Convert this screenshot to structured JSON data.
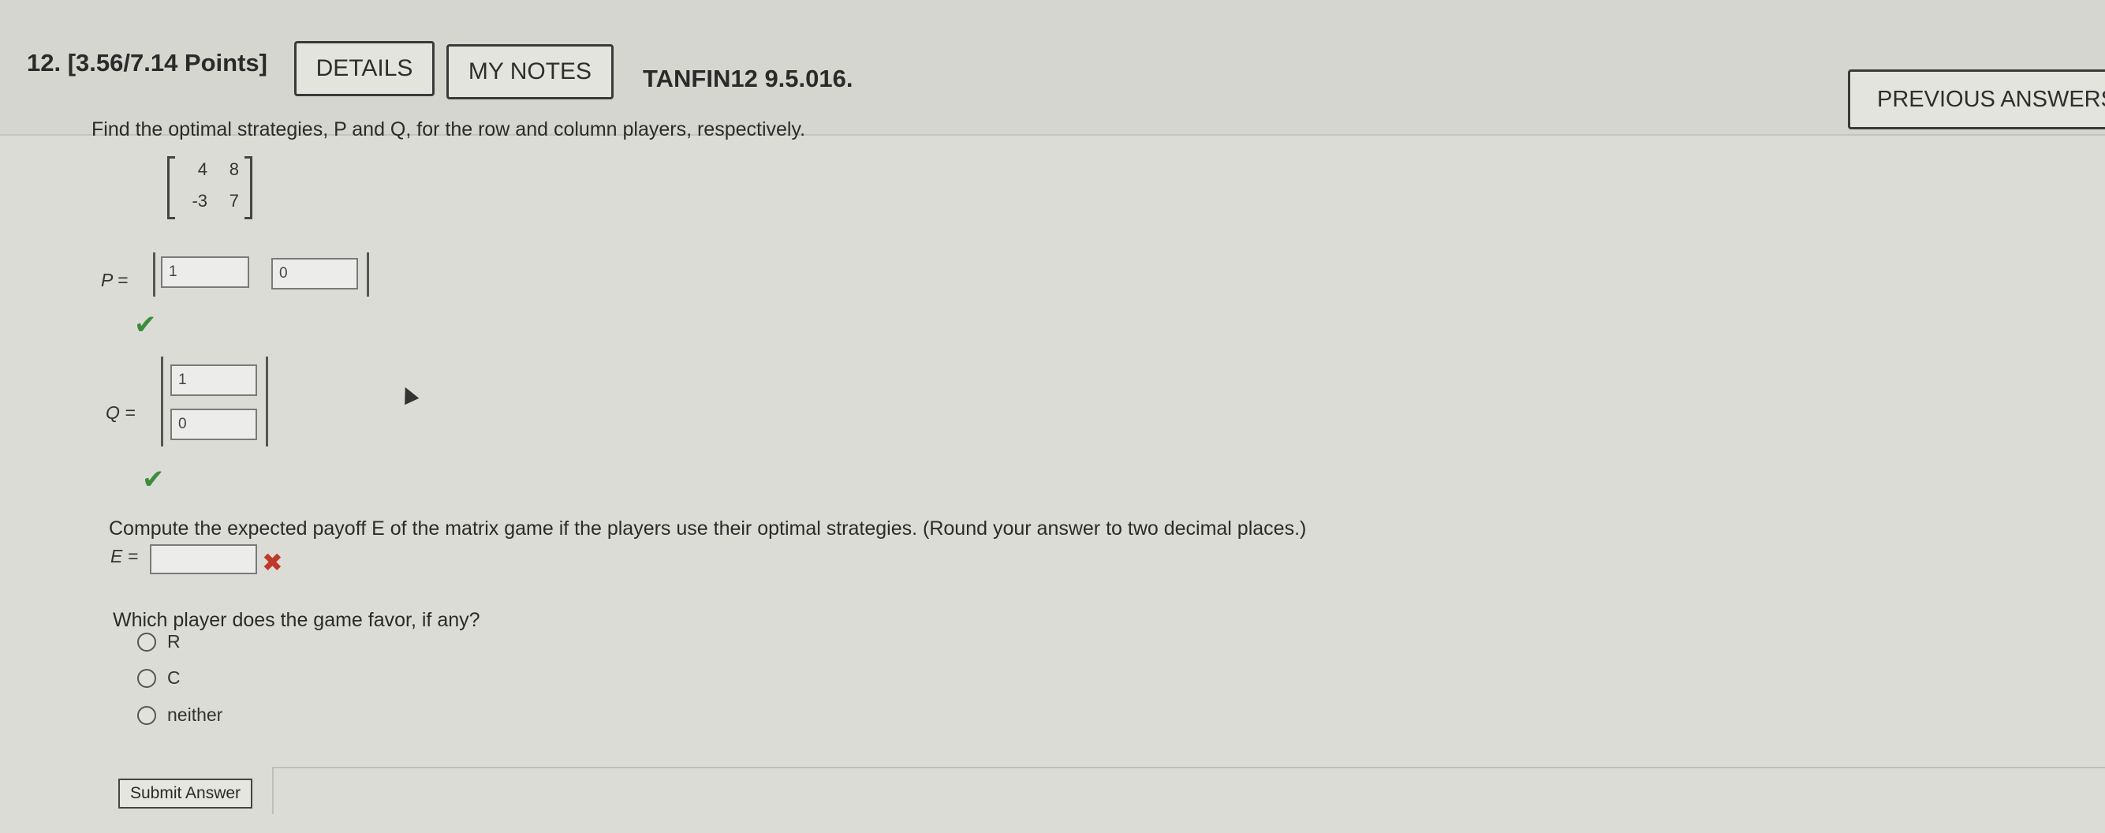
{
  "question": {
    "number_points": "12.  [3.56/7.14 Points]",
    "details_label": "DETAILS",
    "notes_label": "MY NOTES",
    "code": "TANFIN12 9.5.016.",
    "previous_answers_label": "PREVIOUS ANSWERS"
  },
  "prompt": {
    "text": "Find the optimal strategies, P and Q, for the row and column players, respectively."
  },
  "matrix": {
    "rows": [
      [
        "4",
        "8"
      ],
      [
        "-3",
        "7"
      ]
    ]
  },
  "P": {
    "label": "P =",
    "values": [
      "1",
      "0"
    ]
  },
  "Q": {
    "label": "Q =",
    "values": [
      "1",
      "0"
    ]
  },
  "expected": {
    "text": "Compute the expected payoff E of the matrix game if the players use their optimal strategies. (Round your answer to two decimal places.)",
    "label": "E =",
    "value": ""
  },
  "favor": {
    "question": "Which player does the game favor, if any?",
    "options": [
      "R",
      "C",
      "neither"
    ]
  },
  "submit_label": "Submit Answer",
  "colors": {
    "correct": "#3c8c3c",
    "incorrect": "#c0392b"
  }
}
